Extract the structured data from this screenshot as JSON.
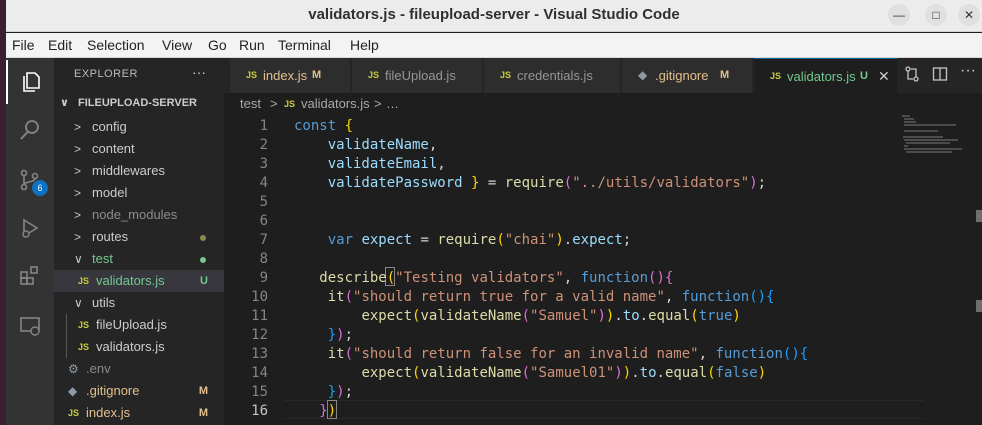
{
  "window": {
    "title": "validators.js - fileupload-server - Visual Studio Code",
    "minimize_glyph": "—",
    "maximize_glyph": "□",
    "close_glyph": "✕"
  },
  "menu": [
    "File",
    "Edit",
    "Selection",
    "View",
    "Go",
    "Run",
    "Terminal",
    "Help"
  ],
  "activity_bar": {
    "items": [
      "explorer-icon",
      "search-icon",
      "source-control-icon",
      "run-debug-icon",
      "extensions-icon",
      "remote-explorer-icon"
    ],
    "source_control_badge": "6"
  },
  "sidebar": {
    "title": "EXPLORER",
    "more_actions": "···",
    "root": {
      "chevron": "∨",
      "label": "FILEUPLOAD-SERVER"
    },
    "tree": [
      {
        "chevron": ">",
        "label": "config",
        "status": "",
        "color": "#cccccc"
      },
      {
        "chevron": ">",
        "label": "content",
        "status": "",
        "color": "#cccccc"
      },
      {
        "chevron": ">",
        "label": "middlewares",
        "status": "",
        "color": "#cccccc"
      },
      {
        "chevron": ">",
        "label": "model",
        "status": "",
        "color": "#cccccc"
      },
      {
        "chevron": ">",
        "label": "node_modules",
        "status": "",
        "color": "#8c8c8c"
      },
      {
        "chevron": ">",
        "label": "routes",
        "status": "dot",
        "color": "#cccccc",
        "dot_color": "#8a8a4e"
      },
      {
        "chevron": "∨",
        "label": "test",
        "status": "dot",
        "color": "#73c991",
        "dot_color": "#73c991"
      },
      {
        "icon": "JS",
        "label": "validators.js",
        "status": "U",
        "color": "#73c991",
        "selected": true
      },
      {
        "chevron": "∨",
        "label": "utils",
        "status": "",
        "color": "#cccccc"
      },
      {
        "icon": "JS",
        "label": "fileUpload.js",
        "status": "",
        "color": "#cccccc"
      },
      {
        "icon": "JS",
        "label": "validators.js",
        "status": "",
        "color": "#cccccc"
      },
      {
        "icon": "⚙",
        "label": ".env",
        "status": "",
        "color": "#8c8c8c"
      },
      {
        "icon": "◆",
        "label": ".gitignore",
        "status": "M",
        "color": "#e2c08d"
      },
      {
        "icon": "JS",
        "label": "index.js",
        "status": "M",
        "color": "#e2c08d"
      }
    ]
  },
  "tabs": [
    {
      "icon": "JS",
      "label": "index.js",
      "status": "M",
      "active": false
    },
    {
      "icon": "JS",
      "label": "fileUpload.js",
      "status": "",
      "active": false
    },
    {
      "icon": "JS",
      "label": "credentials.js",
      "status": "",
      "active": false
    },
    {
      "icon": "◆",
      "label": ".gitignore",
      "status": "M",
      "active": false
    },
    {
      "icon": "JS",
      "label": "validators.js",
      "status": "U",
      "active": true,
      "close": "✕"
    }
  ],
  "tab_actions": [
    "compare-changes-icon",
    "split-editor-icon",
    "more-actions-icon"
  ],
  "breadcrumb": {
    "folder": "test",
    "separator": ">",
    "file_icon": "JS",
    "file": "validators.js",
    "trail": "…"
  },
  "editor": {
    "current_line": 16,
    "lines": [
      {
        "n": 1,
        "t": [
          [
            "k",
            "const "
          ],
          [
            "b1",
            "{"
          ]
        ]
      },
      {
        "n": 2,
        "t": [
          [
            "p",
            "    "
          ],
          [
            "v",
            "validateName"
          ],
          [
            "p",
            ","
          ]
        ]
      },
      {
        "n": 3,
        "t": [
          [
            "p",
            "    "
          ],
          [
            "v",
            "validateEmail"
          ],
          [
            "p",
            ","
          ]
        ]
      },
      {
        "n": 4,
        "t": [
          [
            "p",
            "    "
          ],
          [
            "v",
            "validatePassword"
          ],
          [
            "p",
            " "
          ],
          [
            "b1",
            "}"
          ],
          [
            "p",
            " = "
          ],
          [
            "f",
            "require"
          ],
          [
            "b2",
            "("
          ],
          [
            "s",
            "\"../utils/validators\""
          ],
          [
            "b2",
            ")"
          ],
          [
            "p",
            ";"
          ]
        ]
      },
      {
        "n": 5,
        "t": []
      },
      {
        "n": 6,
        "t": []
      },
      {
        "n": 7,
        "t": [
          [
            "p",
            "    "
          ],
          [
            "k",
            "var "
          ],
          [
            "v",
            "expect"
          ],
          [
            "p",
            " = "
          ],
          [
            "f",
            "require"
          ],
          [
            "b1",
            "("
          ],
          [
            "s",
            "\"chai\""
          ],
          [
            "b1",
            ")"
          ],
          [
            "p",
            "."
          ],
          [
            "v",
            "expect"
          ],
          [
            "p",
            ";"
          ]
        ]
      },
      {
        "n": 8,
        "t": []
      },
      {
        "n": 9,
        "t": [
          [
            "p",
            "   "
          ],
          [
            "f",
            "describe"
          ],
          [
            "b1",
            "("
          ],
          [
            "s",
            "\"Testing validators\""
          ],
          [
            "p",
            ", "
          ],
          [
            "k",
            "function"
          ],
          [
            "b2",
            "()"
          ],
          [
            "b2",
            "{"
          ]
        ]
      },
      {
        "n": 10,
        "t": [
          [
            "p",
            "    "
          ],
          [
            "f",
            "it"
          ],
          [
            "b2",
            "("
          ],
          [
            "s",
            "\"should return true for a valid name\""
          ],
          [
            "p",
            ", "
          ],
          [
            "k",
            "function"
          ],
          [
            "b3",
            "()"
          ],
          [
            "b3",
            "{"
          ]
        ]
      },
      {
        "n": 11,
        "t": [
          [
            "p",
            "        "
          ],
          [
            "f",
            "expect"
          ],
          [
            "b1",
            "("
          ],
          [
            "f",
            "validateName"
          ],
          [
            "b2",
            "("
          ],
          [
            "s",
            "\"Samuel\""
          ],
          [
            "b2",
            ")"
          ],
          [
            "b1",
            ")"
          ],
          [
            "p",
            "."
          ],
          [
            "v",
            "to"
          ],
          [
            "p",
            "."
          ],
          [
            "f",
            "equal"
          ],
          [
            "b1",
            "("
          ],
          [
            "k",
            "true"
          ],
          [
            "b1",
            ")"
          ]
        ]
      },
      {
        "n": 12,
        "t": [
          [
            "p",
            "    "
          ],
          [
            "b3",
            "}"
          ],
          [
            "b2",
            ")"
          ],
          [
            "p",
            ";"
          ]
        ]
      },
      {
        "n": 13,
        "t": [
          [
            "p",
            "    "
          ],
          [
            "f",
            "it"
          ],
          [
            "b2",
            "("
          ],
          [
            "s",
            "\"should return false for an invalid name\""
          ],
          [
            "p",
            ", "
          ],
          [
            "k",
            "function"
          ],
          [
            "b3",
            "()"
          ],
          [
            "b3",
            "{"
          ]
        ]
      },
      {
        "n": 14,
        "t": [
          [
            "p",
            "        "
          ],
          [
            "f",
            "expect"
          ],
          [
            "b1",
            "("
          ],
          [
            "f",
            "validateName"
          ],
          [
            "b2",
            "("
          ],
          [
            "s",
            "\"Samuel01\""
          ],
          [
            "b2",
            ")"
          ],
          [
            "b1",
            ")"
          ],
          [
            "p",
            "."
          ],
          [
            "v",
            "to"
          ],
          [
            "p",
            "."
          ],
          [
            "f",
            "equal"
          ],
          [
            "b1",
            "("
          ],
          [
            "k",
            "false"
          ],
          [
            "b1",
            ")"
          ]
        ]
      },
      {
        "n": 15,
        "t": [
          [
            "p",
            "    "
          ],
          [
            "b3",
            "}"
          ],
          [
            "b2",
            ")"
          ],
          [
            "p",
            ";"
          ]
        ]
      },
      {
        "n": 16,
        "t": [
          [
            "p",
            "   "
          ],
          [
            "b2",
            "}"
          ],
          [
            "b1",
            ")"
          ]
        ]
      }
    ]
  },
  "colors": {
    "accent": "#0e639c",
    "untracked": "#73c991",
    "modified": "#e2c08d",
    "js_icon": "#cbcb41"
  }
}
